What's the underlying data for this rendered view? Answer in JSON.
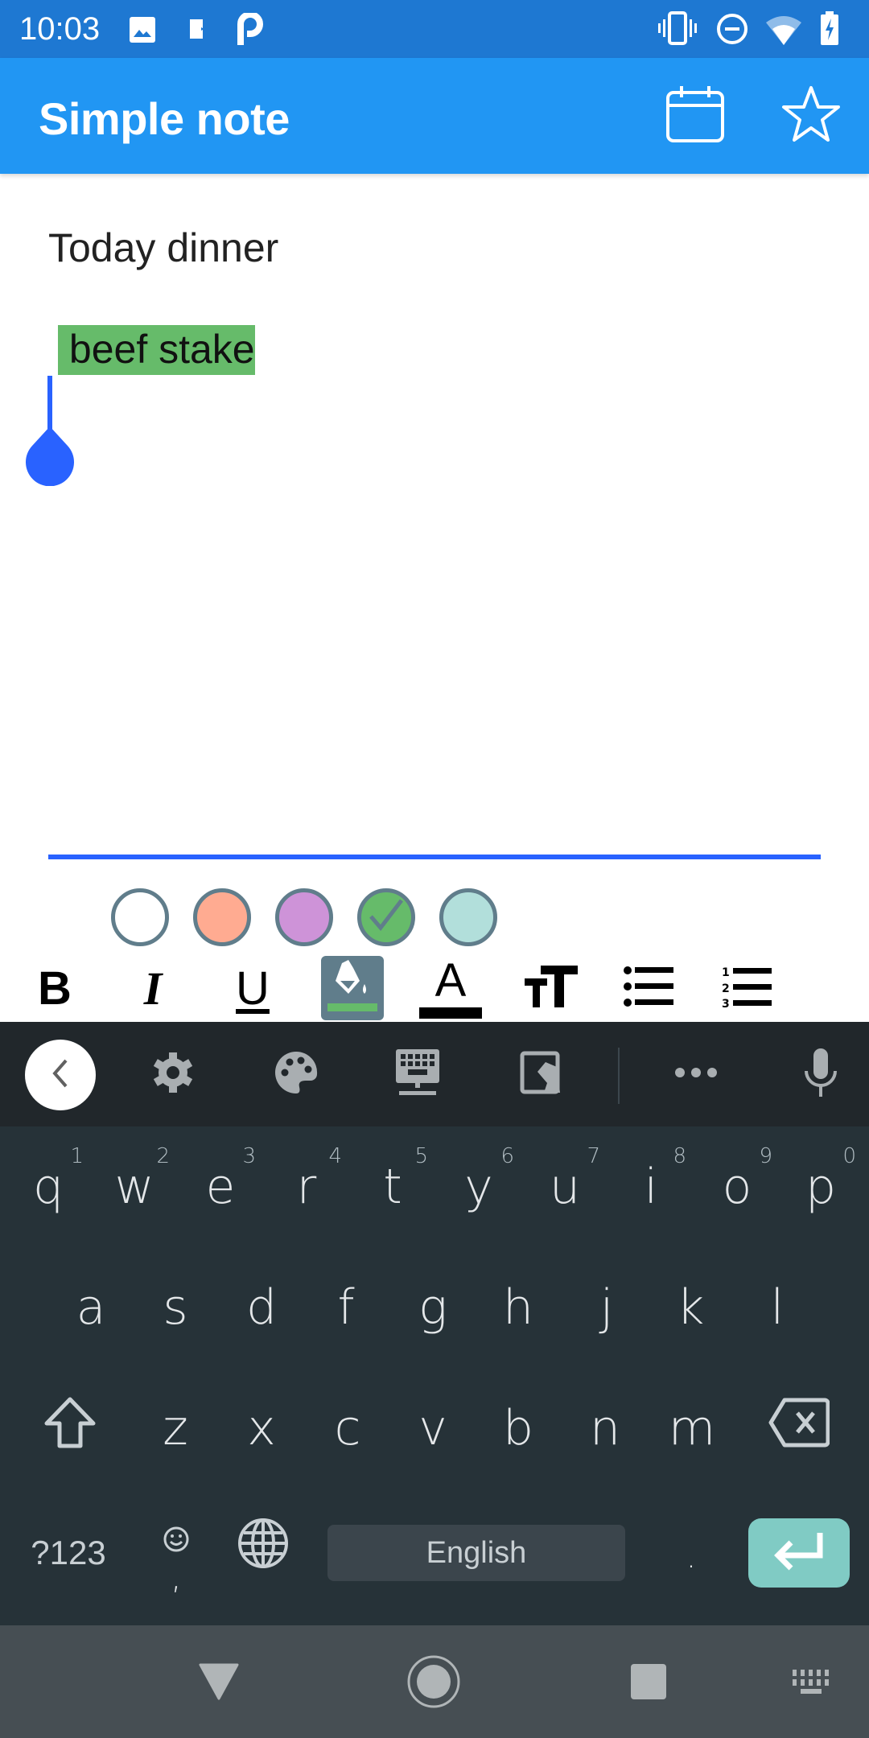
{
  "status_bar": {
    "time": "10:03",
    "left_icons": [
      "gallery-icon",
      "sd-card-icon",
      "p-app-icon"
    ],
    "right_icons": [
      "vibrate-icon",
      "do-not-disturb-icon",
      "wifi-icon",
      "battery-charging-icon"
    ]
  },
  "app_bar": {
    "title": "Simple note",
    "actions": [
      "calendar-icon",
      "star-icon"
    ]
  },
  "note": {
    "title": "Today dinner",
    "body_highlighted": " beef stake",
    "highlight_color": "#66bb6a"
  },
  "palette": {
    "colors": [
      {
        "name": "white",
        "hex": "#ffffff",
        "selected": false
      },
      {
        "name": "salmon",
        "hex": "#ffab91",
        "selected": false
      },
      {
        "name": "violet",
        "hex": "#ce93d8",
        "selected": false
      },
      {
        "name": "green",
        "hex": "#66bb6a",
        "selected": true
      },
      {
        "name": "light-teal",
        "hex": "#b2dfdb",
        "selected": false
      }
    ],
    "border_color": "#607d8b"
  },
  "format_toolbar": {
    "buttons": [
      {
        "name": "bold",
        "label": "B"
      },
      {
        "name": "italic",
        "label": "I"
      },
      {
        "name": "underline",
        "label": "U"
      },
      {
        "name": "highlight",
        "active": true
      },
      {
        "name": "text-color",
        "label": "A"
      },
      {
        "name": "text-size",
        "label": "tT"
      },
      {
        "name": "bullet-list"
      },
      {
        "name": "numbered-list"
      }
    ]
  },
  "keyboard": {
    "toolbar": [
      "back",
      "settings",
      "theme",
      "one-handed",
      "clipboard-hand",
      "more",
      "voice"
    ],
    "row1": [
      {
        "key": "q",
        "hint": "1"
      },
      {
        "key": "w",
        "hint": "2"
      },
      {
        "key": "e",
        "hint": "3"
      },
      {
        "key": "r",
        "hint": "4"
      },
      {
        "key": "t",
        "hint": "5"
      },
      {
        "key": "y",
        "hint": "6"
      },
      {
        "key": "u",
        "hint": "7"
      },
      {
        "key": "i",
        "hint": "8"
      },
      {
        "key": "o",
        "hint": "9"
      },
      {
        "key": "p",
        "hint": "0"
      }
    ],
    "row2": [
      "a",
      "s",
      "d",
      "f",
      "g",
      "h",
      "j",
      "k",
      "l"
    ],
    "row3": [
      "z",
      "x",
      "c",
      "v",
      "b",
      "n",
      "m"
    ],
    "symbols_label": "?123",
    "comma": ",",
    "period": ".",
    "space_label": "English",
    "enter_color": "#80cbc4"
  },
  "nav_bar": {
    "buttons": [
      "back",
      "home",
      "recents",
      "keyboard-switch"
    ]
  }
}
